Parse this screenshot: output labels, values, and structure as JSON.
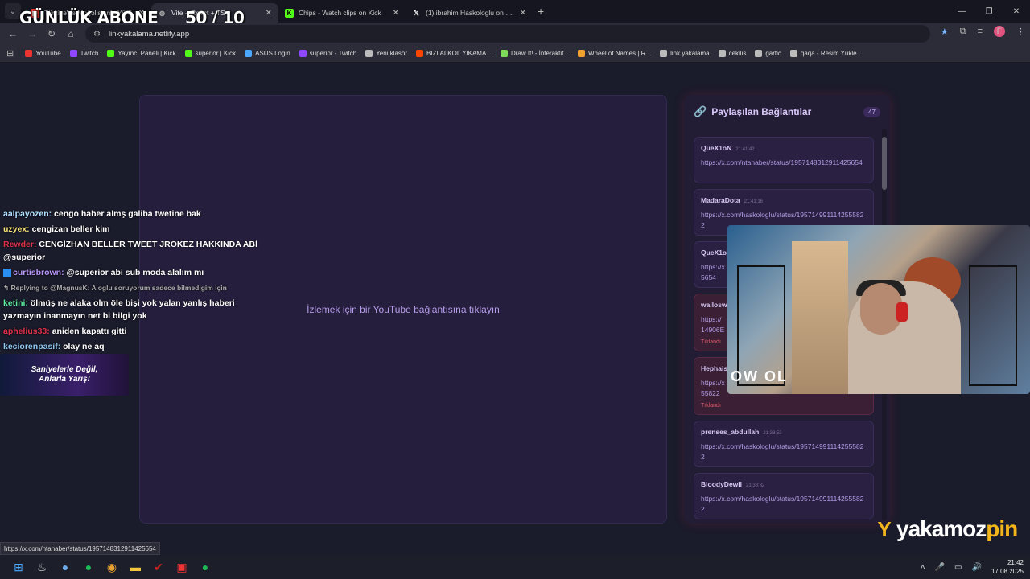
{
  "overlay": {
    "title": "GÜNLÜK ABONE",
    "counter": "50 / 10"
  },
  "tabs": [
    {
      "title": "Türkiye'de Moğolistan'a Yürü",
      "favicon": "youtube-icon",
      "active": false
    },
    {
      "title": "Vite + React + TS",
      "favicon": "globe-icon",
      "active": true
    },
    {
      "title": "Chips - Watch clips on Kick",
      "favicon": "kick-icon",
      "active": false
    },
    {
      "title": "(1) ibrahim Haskologlu on X: \"J",
      "favicon": "x-icon",
      "active": false
    }
  ],
  "address": {
    "url": "linkyakalama.netlify.app"
  },
  "profile_initial": "F",
  "bookmarks": [
    {
      "label": "YouTube",
      "icon": "youtube-icon",
      "color": "#e33"
    },
    {
      "label": "Twitch",
      "icon": "twitch-icon",
      "color": "#9147ff"
    },
    {
      "label": "Yayıncı Paneli | Kick",
      "icon": "kick-icon",
      "color": "#53fc18"
    },
    {
      "label": "superior | Kick",
      "icon": "kick-icon",
      "color": "#53fc18"
    },
    {
      "label": "ASUS Login",
      "icon": "asus-icon",
      "color": "#4aa8ff"
    },
    {
      "label": "superior - Twitch",
      "icon": "twitch-icon",
      "color": "#9147ff"
    },
    {
      "label": "Yeni klasör",
      "icon": "folder-icon",
      "color": "#bbb"
    },
    {
      "label": "BIZI ALKOL YIKAMA...",
      "icon": "reddit-icon",
      "color": "#ff4500"
    },
    {
      "label": "Draw It! - İnteraktif...",
      "icon": "draw-icon",
      "color": "#7ed957"
    },
    {
      "label": "Wheel of Names | R...",
      "icon": "wheel-icon",
      "color": "#f0a030"
    },
    {
      "label": "link yakalama",
      "icon": "globe-icon",
      "color": "#bbb"
    },
    {
      "label": "cekilis",
      "icon": "globe-icon",
      "color": "#bbb"
    },
    {
      "label": "gartic",
      "icon": "globe-icon",
      "color": "#bbb"
    },
    {
      "label": "qaqa - Resim Yükle...",
      "icon": "image-icon",
      "color": "#bbb"
    }
  ],
  "player": {
    "message": "İzlemek için bir YouTube bağlantısına tıklayın"
  },
  "links_panel": {
    "title": "Paylaşılan Bağlantılar",
    "count": "47",
    "items": [
      {
        "user": "QueX1oN",
        "time": "21:41:42",
        "url": "https://x.com/ntahaber/status/1957148312911425654",
        "tag": ""
      },
      {
        "user": "MadaraDota",
        "time": "21:41:16",
        "url": "https://x.com/haskologlu/status/1957149911142555822",
        "tag": ""
      },
      {
        "user": "QueX1o",
        "time": "",
        "url": "https://x",
        "url2": "5654",
        "tag": ""
      },
      {
        "user": "wallosw",
        "time": "",
        "url": "https://",
        "url2": "14906E",
        "tag": "Tıklandı"
      },
      {
        "user": "Hephais",
        "time": "",
        "url": "https://x",
        "url2": "55822",
        "tag": "Tıklandı"
      },
      {
        "user": "prenses_abdullah",
        "time": "21:38:53",
        "url": "https://x.com/haskologlu/status/1957149911142555822",
        "tag": ""
      },
      {
        "user": "BloodyDewil",
        "time": "21:38:32",
        "url": "https://x.com/haskologlu/status/1957149911142555822",
        "tag": ""
      }
    ]
  },
  "chat": [
    {
      "user": "aalpayozen:",
      "color": "#b4e0ff",
      "text": "cengo haber almş galiba twetine bak"
    },
    {
      "user": "uzyex:",
      "color": "#f5e27a",
      "text": "cengizan beller kim"
    },
    {
      "user": "Rewder:",
      "color": "#e0304a",
      "text": "CENGİZHAN BELLER TWEET JROKEZ HAKKINDA ABİ @superior"
    },
    {
      "user": "curtisbrown:",
      "color": "#b794f6",
      "text": "@superior abi sub moda alalım mı"
    },
    {
      "reply": "Replying to @MagnusK: A oglu soruyorum sadece bilmedigim için"
    },
    {
      "user": "ketini:",
      "color": "#5ef0a0",
      "text": "ölmüş ne alaka olm öle bişi yok yalan yanlış haberi yazmayın inanmayın net bi bilgi yok"
    },
    {
      "user": "aphelius33:",
      "color": "#e0304a",
      "text": "aniden kapattı gitti"
    },
    {
      "user": "keciorenpasif:",
      "color": "#8ec8f0",
      "text": "olay ne aq"
    }
  ],
  "promo": {
    "line1": "Saniyelerle Değil,",
    "line2": "Anlarla Yarış!"
  },
  "cam": {
    "sign": "OW OL"
  },
  "brand": {
    "part1": "yakamoz",
    "part2": "pin"
  },
  "status_url": "https://x.com/ntahaber/status/1957148312911425654",
  "clock": {
    "time": "21:42",
    "date": "17.08.2025"
  }
}
